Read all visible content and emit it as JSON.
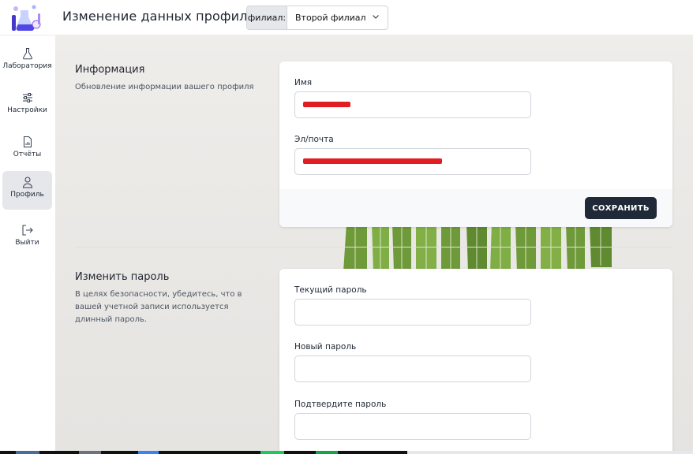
{
  "header": {
    "title": "Изменение данных профиля",
    "branch_label": "филиал:",
    "branch_value": "Второй филиал"
  },
  "sidebar": {
    "items": [
      {
        "label": "Лаборатория",
        "icon": "flask-icon"
      },
      {
        "label": "Настройки",
        "icon": "sliders-icon"
      },
      {
        "label": "Отчёты",
        "icon": "report-icon"
      },
      {
        "label": "Профиль",
        "icon": "user-icon",
        "active": true
      },
      {
        "label": "Выйти",
        "icon": "logout-icon"
      }
    ]
  },
  "info_section": {
    "title": "Информация",
    "description": "Обновление информации вашего профиля",
    "name_label": "Имя",
    "email_label": "Эл/почта",
    "save_label": "СОХРАНИТЬ"
  },
  "password_section": {
    "title": "Изменить пароль",
    "description": "В целях безопасности, убедитесь, что в вашей учетной записи используется длинный пароль.",
    "current_label": "Текущий пароль",
    "new_label": "Новый пароль",
    "confirm_label": "Подтвердите пароль"
  },
  "colors": {
    "accent_dark": "#1f2937",
    "redaction": "#e11d24",
    "active_nav": "#e5e7eb"
  }
}
